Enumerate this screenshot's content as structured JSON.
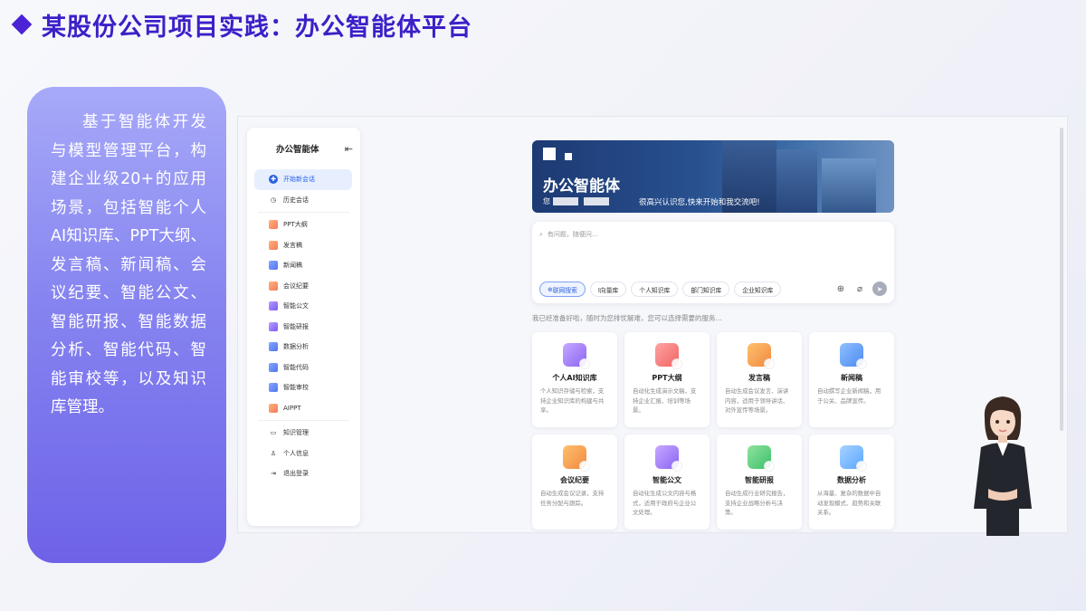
{
  "slide": {
    "title": "某股份公司项目实践：办公智能体平台",
    "description": "基于智能体开发与模型管理平台，构建企业级20+的应用场景，包括智能个人AI知识库、PPT大纲、发言稿、新闻稿、会议纪要、智能公文、智能研报、智能数据分析、智能代码、智能审校等，以及知识库管理。"
  },
  "app": {
    "sidebar": {
      "title": "办公智能体",
      "items": [
        {
          "label": "开始新会话",
          "icon": "chat-plus-icon",
          "active": true
        },
        {
          "label": "历史会话",
          "icon": "history-icon"
        },
        {
          "label": "PPT大纲",
          "icon": "file-icon"
        },
        {
          "label": "发言稿",
          "icon": "file-icon"
        },
        {
          "label": "新闻稿",
          "icon": "folder-icon"
        },
        {
          "label": "会议纪要",
          "icon": "file-icon"
        },
        {
          "label": "智能公文",
          "icon": "purple-doc-icon"
        },
        {
          "label": "智能研报",
          "icon": "purple-doc-icon"
        },
        {
          "label": "数据分析",
          "icon": "folder-icon"
        },
        {
          "label": "智能代码",
          "icon": "folder-icon"
        },
        {
          "label": "智能审校",
          "icon": "folder-icon"
        },
        {
          "label": "AIPPT",
          "icon": "file-icon"
        },
        {
          "label": "知识管理",
          "icon": "book-icon"
        },
        {
          "label": "个人信息",
          "icon": "user-icon"
        },
        {
          "label": "退出登录",
          "icon": "logout-icon"
        }
      ]
    },
    "banner": {
      "title": "办公智能体",
      "sub_prefix": "您",
      "greeting": "很高兴认识您,快来开始和我交流吧!"
    },
    "chat": {
      "placeholder": "有问题，随便问...",
      "pills": [
        "联网搜索",
        "I向量库",
        "个人知识库",
        "部门知识库",
        "企业知识库"
      ]
    },
    "hint": "我已经准备好啦，随时为您排忧解难，您可以选择需要的服务...",
    "cards": [
      {
        "title": "个人AI知识库",
        "desc": "个人知识存储与检索，支持企业知识库的构建与共享。",
        "color": "g-purple"
      },
      {
        "title": "PPT大纲",
        "desc": "自动化生成演示文稿，支持企业汇报、培训等场景。",
        "color": "g-red"
      },
      {
        "title": "发言稿",
        "desc": "自动生成会议发言、演讲内容，适用于领导讲话、对外宣传等场景。",
        "color": "g-orange"
      },
      {
        "title": "新闻稿",
        "desc": "自动撰写企业新闻稿，用于公关、品牌宣传。",
        "color": "g-blue"
      },
      {
        "title": "会议纪要",
        "desc": "自动生成会议记录，支持任务分配与跟踪。",
        "color": "g-orange"
      },
      {
        "title": "智能公文",
        "desc": "自动化生成公文内容与格式，适用于政府与企业公文处理。",
        "color": "g-purple"
      },
      {
        "title": "智能研报",
        "desc": "自动生成行业研究报告，支持企业战略分析与决策。",
        "color": "g-green"
      },
      {
        "title": "数据分析",
        "desc": "从海量、复杂的数据中自动发现模式、趋势和关联关系。",
        "color": "g-sky"
      }
    ]
  },
  "colors": {
    "accent": "#3b20c8",
    "primary": "#2860e8"
  }
}
